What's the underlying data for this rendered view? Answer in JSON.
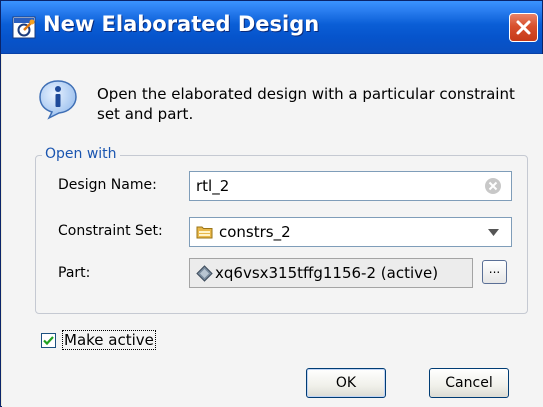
{
  "window": {
    "title": "New Elaborated Design",
    "title_icon": "vivado-app-icon",
    "close_icon": "close-icon"
  },
  "info": {
    "icon": "info-icon",
    "message": "Open the elaborated design with a particular constraint set and part."
  },
  "group": {
    "legend": "Open with",
    "design_name": {
      "label": "Design Name:",
      "value": "rtl_2",
      "clear_icon": "clear-field-icon"
    },
    "constraint_set": {
      "label": "Constraint Set:",
      "value": "constrs_2",
      "icon": "folder-icon",
      "arrow_icon": "dropdown-arrow-icon"
    },
    "part": {
      "label": "Part:",
      "value": "xq6vsx315tffg1156-2 (active)",
      "icon": "chip-icon",
      "browse_label": "..."
    }
  },
  "make_active": {
    "label": "Make active",
    "checked": true
  },
  "buttons": {
    "ok_label": "OK",
    "cancel_label": "Cancel"
  },
  "colors": {
    "titlebar": "#0a5ed6",
    "close_button": "#d8502d",
    "legend_text": "#1a55b0",
    "dialog_bg": "#f4f4f4"
  }
}
